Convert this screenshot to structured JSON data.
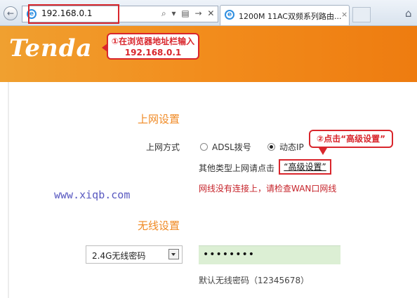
{
  "browser": {
    "address": "192.168.0.1",
    "address_tools": "⌕ ▾ ▤ → ✕",
    "tab_title": "1200M 11AC双频系列路由...",
    "tab_close": "×",
    "back_icon": "←",
    "home_icon": "⌂"
  },
  "header": {
    "logo": "Tenda",
    "callout_step1": "①在浏览器地址栏输入192.168.0.1"
  },
  "internet": {
    "section_title": "上网设置",
    "mode_label": "上网方式",
    "options": [
      {
        "label": "ADSL拨号",
        "selected": false
      },
      {
        "label": "动态IP",
        "selected": true
      }
    ],
    "other_type_text": "其他类型上网请点击",
    "advanced_link": "“高级设置”",
    "callout_step2": "②点击“高级设置”",
    "warning": "网线没有连接上，请检查WAN口网线"
  },
  "watermark": "www.xiqb.com",
  "wireless": {
    "section_title": "无线设置",
    "select_value": "2.4G无线密码",
    "password_value": "••••••••",
    "default_hint": "默认无线密码（12345678）"
  },
  "colors": {
    "brand_orange": "#f28c1c",
    "annotation_red": "#d9262c",
    "warning_red": "#c6232a",
    "password_bg": "#dcefd4"
  }
}
